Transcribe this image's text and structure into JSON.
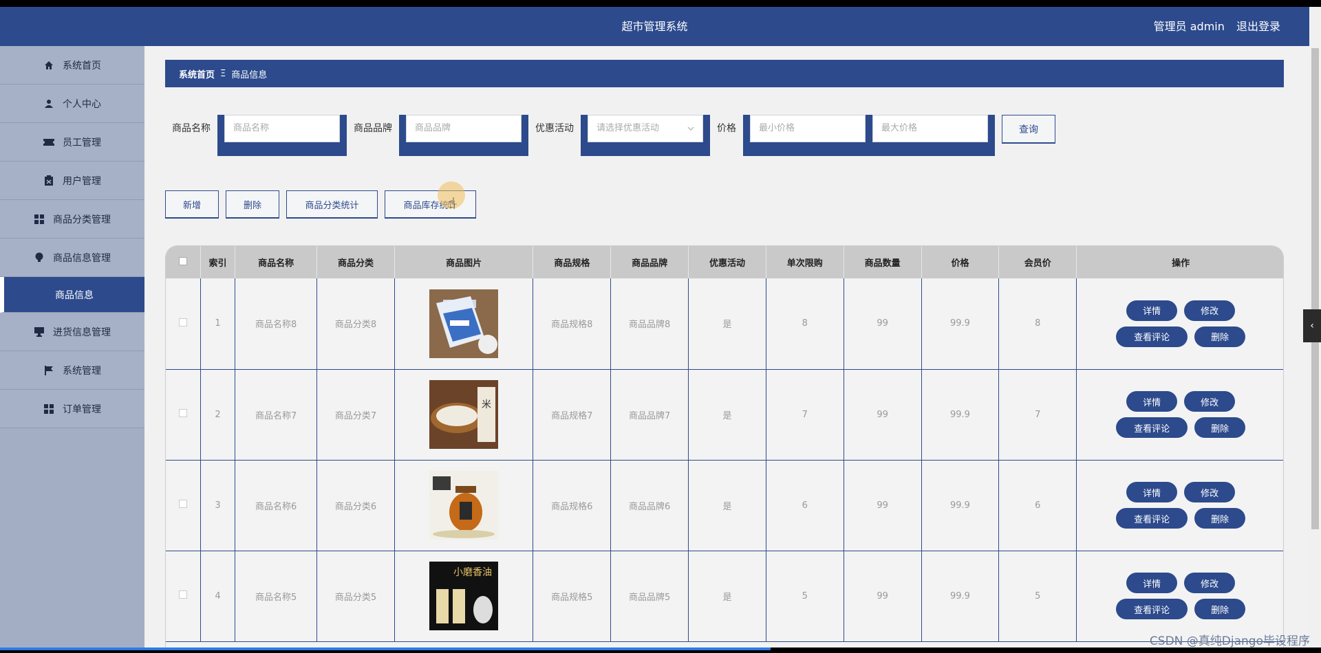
{
  "header": {
    "title": "超市管理系统",
    "user_label": "管理员 admin",
    "logout": "退出登录"
  },
  "sidebar": {
    "items": [
      {
        "label": "系统首页",
        "icon": "home-icon"
      },
      {
        "label": "个人中心",
        "icon": "user-icon"
      },
      {
        "label": "员工管理",
        "icon": "ticket-icon"
      },
      {
        "label": "用户管理",
        "icon": "clipboard-icon"
      },
      {
        "label": "商品分类管理",
        "icon": "grid-icon"
      },
      {
        "label": "商品信息管理",
        "icon": "bulb-icon"
      },
      {
        "label": "商品信息",
        "sub": true
      },
      {
        "label": "进货信息管理",
        "icon": "monitor-icon"
      },
      {
        "label": "系统管理",
        "icon": "flag-icon"
      },
      {
        "label": "订单管理",
        "icon": "grid-icon"
      }
    ]
  },
  "breadcrumb": {
    "home": "系统首页",
    "sep": "Ξ",
    "current": "商品信息"
  },
  "search": {
    "name_label": "商品名称",
    "name_placeholder": "商品名称",
    "brand_label": "商品品牌",
    "brand_placeholder": "商品品牌",
    "promo_label": "优惠活动",
    "promo_placeholder": "请选择优惠活动",
    "price_label": "价格",
    "min_placeholder": "最小价格",
    "max_placeholder": "最大价格",
    "query_button": "查询"
  },
  "actions": {
    "add": "新增",
    "delete": "删除",
    "category_stats": "商品分类统计",
    "stock_stats": "商品库存统计"
  },
  "table": {
    "headers": [
      "索引",
      "商品名称",
      "商品分类",
      "商品图片",
      "商品规格",
      "商品品牌",
      "优惠活动",
      "单次限购",
      "商品数量",
      "价格",
      "会员价",
      "操作"
    ],
    "rows": [
      {
        "index": "1",
        "name": "商品名称8",
        "category": "商品分类8",
        "spec": "商品规格8",
        "brand": "商品品牌8",
        "promo": "是",
        "limit": "8",
        "qty": "99",
        "price": "99.9",
        "member_price": "8"
      },
      {
        "index": "2",
        "name": "商品名称7",
        "category": "商品分类7",
        "spec": "商品规格7",
        "brand": "商品品牌7",
        "promo": "是",
        "limit": "7",
        "qty": "99",
        "price": "99.9",
        "member_price": "7"
      },
      {
        "index": "3",
        "name": "商品名称6",
        "category": "商品分类6",
        "spec": "商品规格6",
        "brand": "商品品牌6",
        "promo": "是",
        "limit": "6",
        "qty": "99",
        "price": "99.9",
        "member_price": "6"
      },
      {
        "index": "4",
        "name": "商品名称5",
        "category": "商品分类5",
        "spec": "商品规格5",
        "brand": "商品品牌5",
        "promo": "是",
        "limit": "5",
        "qty": "99",
        "price": "99.9",
        "member_price": "5"
      }
    ],
    "ops": {
      "detail": "详情",
      "edit": "修改",
      "comments": "查看评论",
      "delete": "删除"
    }
  },
  "watermark": "CSDN @真纯Django毕设程序",
  "colors": {
    "primary": "#2c4a8c",
    "sidebar": "#a3aec4"
  }
}
